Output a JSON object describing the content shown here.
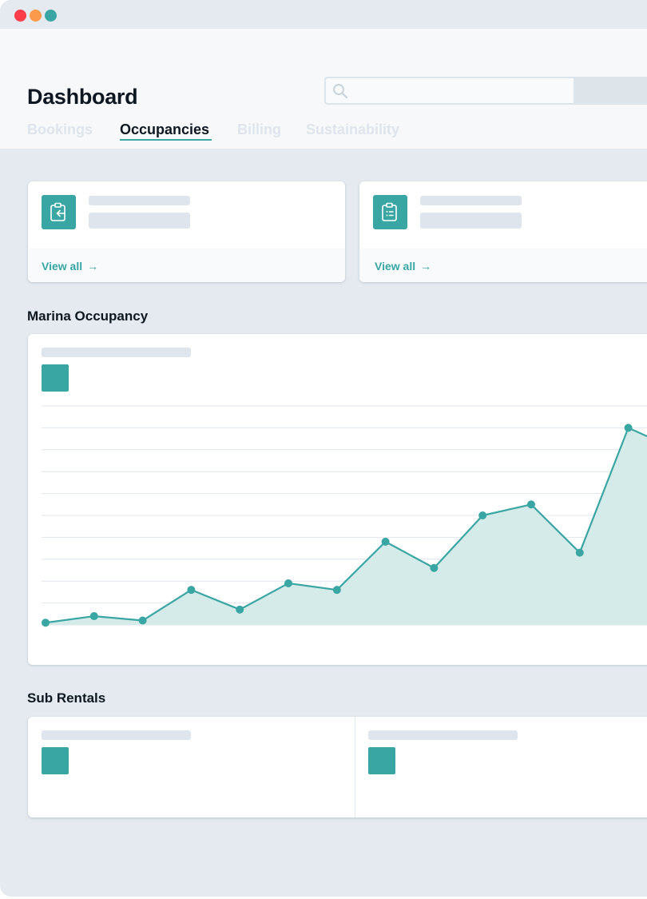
{
  "window": {
    "controls": [
      "close",
      "minimize",
      "maximize"
    ],
    "colors": {
      "close": "#fc3d4a",
      "minimize": "#fb9a4b",
      "maximize": "#3aa6a3"
    }
  },
  "header": {
    "title": "Dashboard",
    "search": {
      "placeholder": ""
    },
    "tabs": [
      {
        "label": "Bookings",
        "active": false
      },
      {
        "label": "Occupancies",
        "active": true
      },
      {
        "label": "Billing",
        "active": false
      },
      {
        "label": "Sustainability",
        "active": false
      }
    ]
  },
  "stat_cards": [
    {
      "icon": "clipboard-import-icon",
      "link_label": "View all"
    },
    {
      "icon": "clipboard-list-icon",
      "link_label": "View all"
    }
  ],
  "sections": {
    "occupancy_title": "Marina Occupancy",
    "sub_rentals_title": "Sub Rentals"
  },
  "colors": {
    "accent": "#3aa6a3",
    "area_fill": "#d5ebe9",
    "grid": "#e0e6ec",
    "skeleton": "#dfe5ec"
  },
  "chart_data": {
    "type": "area",
    "title": "",
    "xlabel": "",
    "ylabel": "",
    "x": [
      1,
      2,
      3,
      4,
      5,
      6,
      7,
      8,
      9,
      10,
      11,
      12,
      13,
      14
    ],
    "series": [
      {
        "values": [
          1,
          4,
          2,
          16,
          7,
          19,
          16,
          38,
          26,
          50,
          55,
          33,
          90,
          80
        ]
      }
    ],
    "ylim": [
      0,
      100
    ],
    "grid": true,
    "legend": "none"
  }
}
